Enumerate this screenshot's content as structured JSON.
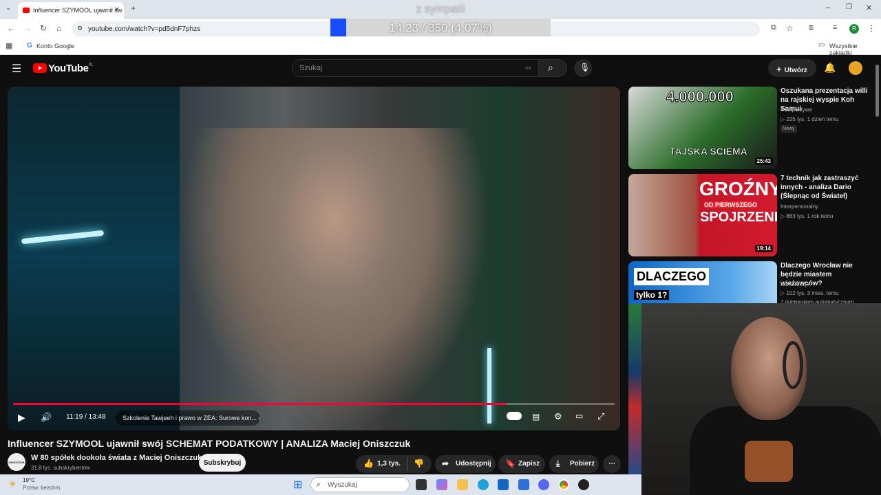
{
  "browser": {
    "tab_title": "Influencer SZYMOOL ujawnił sw...",
    "url": "youtube.com/watch?v=pd5dnF7phzs",
    "bookmark": "Konto Google",
    "all_bookmarks": "Wszystkie zakładki",
    "profile_initial": "R"
  },
  "overlay": {
    "title": "z sympatii",
    "progress_text": "14.23 / 350 (4.07%)",
    "progress_fraction": 0.0407
  },
  "youtube": {
    "logo": "YouTube",
    "region": "PL",
    "search_placeholder": "Szukaj",
    "create_label": "Utwórz"
  },
  "player": {
    "time": "11:19 / 13:48",
    "progress_fraction": 0.82,
    "chapter": "Szkolenie Tawjeeh i prawo w ZEA: Surowe kon...",
    "chapter_arrow": "›"
  },
  "video": {
    "title": "Influencer SZYMOOL ujawnił swój SCHEMAT PODATKOWY | ANALIZA Maciej Oniszczuk",
    "channel_name": "W 80 spółek dookoła świata z Maciej Oniszczuk",
    "subscribers": "31,8 tys. subskrybentów",
    "avatar_text": "ONISZCZUK",
    "subscribe_label": "Subskrybuj",
    "likes": "1,3 tys.",
    "share_label": "Udostępnij",
    "save_label": "Zapisz",
    "download_label": "Pobierz"
  },
  "recommendations": [
    {
      "title": "Oszukana prezentacja willi na rajskiej wyspie Koh Samui",
      "channel": "Perspektywa",
      "meta": "▷ 225 tys.   1 dzień temu",
      "badge": "Nowy",
      "duration": "25:43",
      "thumb_text_top": "4.000.000",
      "thumb_text_bottom": "TAJSKA ŚCIEMA"
    },
    {
      "title": "7 technik jak zastraszyć innych - analiza Dario (Ślepnąc od Świateł)",
      "channel": "Interpersonalny",
      "meta": "▷ 863 tys.   1 rok temu",
      "badge": "",
      "duration": "19:14",
      "thumb_text_top": "GROŹNY",
      "thumb_text_mid": "OD PIERWSZEGO",
      "thumb_text_bottom": "SPOJRZENIA"
    },
    {
      "title": "Dlaczego Wrocław nie będzie miastem wieżowców?",
      "channel": "Konstrukcje",
      "meta": "▷ 102 tys.   3 mies. temu",
      "badge": "7 dubbingiem automatycznym",
      "duration": "",
      "thumb_text_top": "DLACZEGO",
      "thumb_text_bottom": "tylko 1?"
    }
  ],
  "taskbar": {
    "weather_temp": "19°C",
    "weather_desc": "Przew. bezchm.",
    "search_placeholder": "Wyszukaj"
  },
  "colors": {
    "yt_red": "#ff0000",
    "progress_red": "#ff0033",
    "overlay_blue": "#1a4cff"
  }
}
